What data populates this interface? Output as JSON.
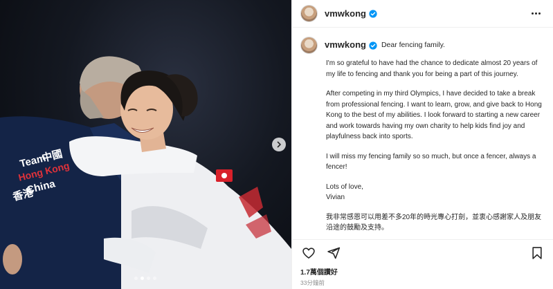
{
  "post": {
    "username": "vmwkong",
    "verified": true,
    "more_label": "More options",
    "media": {
      "carousel_count": 4,
      "carousel_active": 1,
      "jersey_text": [
        "Team",
        "中國",
        "Hong Kong",
        "China",
        "香港"
      ]
    },
    "caption": {
      "greeting": "Dear fencing family.",
      "paragraphs": [
        "I'm so grateful to have had the chance to dedicate almost 20 years of my life to fencing and thank you for being a part of this journey.",
        "After competing in my third Olympics, I have decided to take a break from professional fencing. I want to learn, grow, and give back to Hong Kong to the best of my abilities. I look forward to starting a new career and work towards having my own charity to help kids find joy and playfulness back into sports.",
        "I will miss my fencing family so so much, but once a fencer, always a fencer!",
        "Lots of love,\nVivian",
        "我非常感恩可以用差不多20年的時光專心打劍，並衷心感謝家人及朋友沿途的鼓勵及支持。"
      ]
    },
    "likes": "1.7萬個讚好",
    "time": "33分鐘前"
  },
  "icons": {
    "like": "heart-icon",
    "share": "paper-plane-icon",
    "save": "bookmark-icon",
    "next": "chevron-right-icon",
    "verified": "verified-badge-icon",
    "more": "ellipsis-icon"
  },
  "colors": {
    "verified": "#0095f6",
    "text": "#262626",
    "muted": "#8e8e8e",
    "border": "#efefef"
  }
}
